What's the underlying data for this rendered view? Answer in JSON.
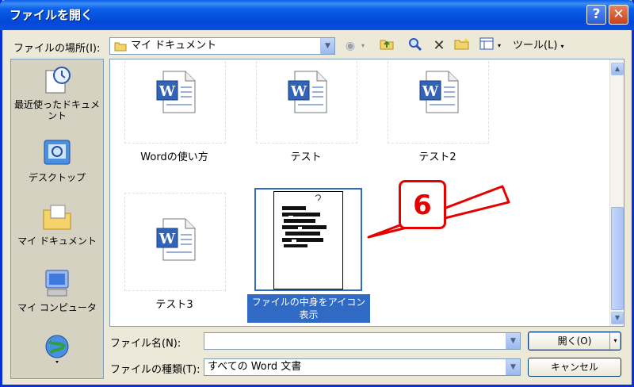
{
  "window": {
    "title": "ファイルを開く",
    "help_label": "?",
    "close_label": "✕"
  },
  "toolbar": {
    "location_label": "ファイルの場所(I):",
    "location_value": "マイ ドキュメント",
    "tools_label": "ツール(L)"
  },
  "places": [
    {
      "label": "最近使ったドキュメント",
      "icon": "recent-documents-icon"
    },
    {
      "label": "デスクトップ",
      "icon": "desktop-icon"
    },
    {
      "label": "マイ ドキュメント",
      "icon": "my-documents-icon"
    },
    {
      "label": "マイ コンピュータ",
      "icon": "my-computer-icon"
    },
    {
      "label": "",
      "icon": "network-places-icon"
    }
  ],
  "files": [
    {
      "name": "Wordの使い方"
    },
    {
      "name": "テスト"
    },
    {
      "name": "テスト2"
    },
    {
      "name": "テスト3"
    }
  ],
  "selected_file": {
    "name": "ファイルの中身をアイコン表示"
  },
  "callout": {
    "number": "6"
  },
  "bottom": {
    "filename_label": "ファイル名(N):",
    "filename_value": "",
    "filetype_label": "ファイルの種類(T):",
    "filetype_value": "すべての Word 文書",
    "open_label": "開く(O)",
    "cancel_label": "キャンセル"
  },
  "colors": {
    "title_bar": "#0a5fe8",
    "selection": "#316ac5",
    "callout": "#e60000"
  }
}
